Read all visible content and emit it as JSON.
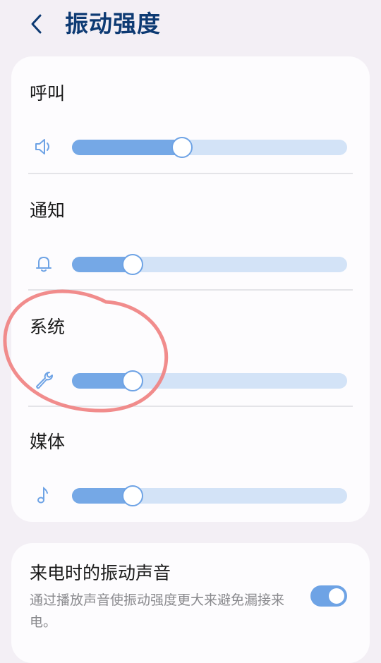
{
  "header": {
    "title": "振动强度",
    "back_icon": "chevron-left-icon"
  },
  "sliders": [
    {
      "label": "呼叫",
      "icon": "speaker-icon",
      "level": 0.4
    },
    {
      "label": "通知",
      "icon": "bell-icon",
      "level": 0.22
    },
    {
      "label": "系统",
      "icon": "wrench-icon",
      "level": 0.22
    },
    {
      "label": "媒体",
      "icon": "music-note-icon",
      "level": 0.22
    }
  ],
  "ringtone_vibration": {
    "title": "来电时的振动声音",
    "description": "通过播放声音使振动强度更大来避免漏接来电。",
    "enabled": true
  },
  "colors": {
    "accent": "#6ea3e5",
    "track": "#d3e3f7",
    "title": "#0d3a73",
    "annotation": "#f08080"
  }
}
